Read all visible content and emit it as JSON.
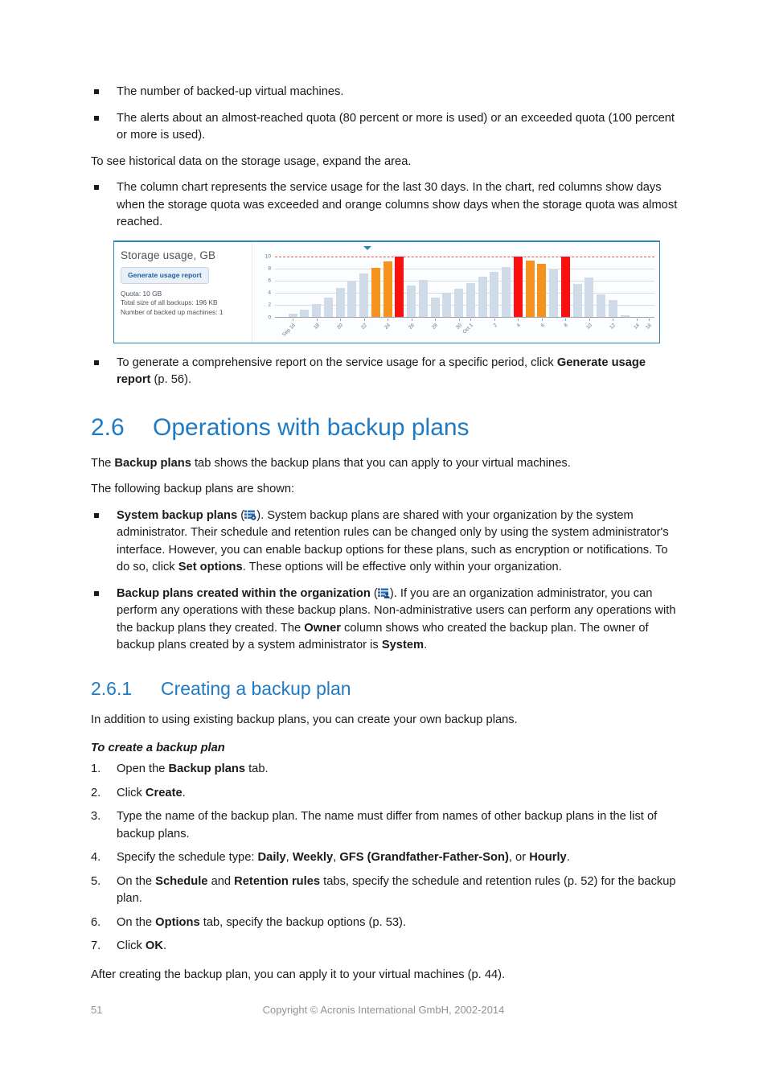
{
  "page": {
    "number": "51",
    "copyright": "Copyright © Acronis International GmbH, 2002-2014"
  },
  "intro_bullets": [
    "The number of backed-up virtual machines.",
    "The alerts about an almost-reached quota (80 percent or more is used) or an exceeded quota (100 percent or more is used)."
  ],
  "intro_paragraph": "To see historical data on the storage usage, expand the area.",
  "chart_bullet": "The column chart represents the service usage for the last 30 days. In the chart, red columns show days when the storage quota was exceeded and orange columns show days when the storage quota was almost reached.",
  "report_bullet": {
    "before": "To generate a comprehensive report on the service usage for a specific period, click ",
    "bold": "Generate usage report",
    "after": " (p. 56)."
  },
  "widget": {
    "title": "Storage usage, GB",
    "button_label": "Generate usage report",
    "quota_text": "Quota: 10 GB",
    "total_size_text": "Total size of all backups: 196 KB",
    "machines_text": "Number of backed up machines: 1",
    "collapse_icon": "caret-down-icon",
    "colors": {
      "normal_bar": "#cfdbe8",
      "warning_bar": "#f6921e",
      "exceeded_bar": "#fb0f0f",
      "quota_line": "#f0504a",
      "accent": "#2e86bf"
    }
  },
  "chart_data": {
    "type": "bar",
    "title": "Storage usage, GB",
    "xlabel": "",
    "ylabel": "",
    "ylim": [
      0,
      10
    ],
    "yticks": [
      0,
      2,
      4,
      6,
      8,
      10
    ],
    "grid": true,
    "legend": null,
    "quota_level": 10,
    "categories": [
      "Sep 15",
      "Sep 16",
      "Sep 17",
      "Sep 18",
      "Sep 19",
      "Sep 20",
      "Sep 21",
      "Sep 22",
      "Sep 23",
      "Sep 24",
      "Sep 25",
      "Sep 26",
      "Sep 27",
      "Sep 28",
      "Sep 29",
      "Sep 30",
      "Oct 1",
      "Oct 2",
      "Oct 3",
      "Oct 4",
      "Oct 5",
      "Oct 6",
      "Oct 7",
      "Oct 8",
      "Oct 9",
      "Oct 10",
      "Oct 11",
      "Oct 12",
      "Oct 13",
      "Oct 14",
      "Oct 15",
      "Oct 16"
    ],
    "tick_labels": [
      "",
      "Sep 16",
      "",
      "18",
      "",
      "20",
      "",
      "22",
      "",
      "24",
      "",
      "26",
      "",
      "28",
      "",
      "30",
      "Oct 1",
      "",
      "2",
      "",
      "4",
      "",
      "6",
      "",
      "8",
      "",
      "10",
      "",
      "12",
      "",
      "14",
      "16"
    ],
    "values": [
      0,
      0.6,
      1.2,
      2.2,
      3.2,
      4.8,
      5.9,
      7.2,
      8.1,
      9.1,
      10,
      5.2,
      6.1,
      3.2,
      4.0,
      4.7,
      5.6,
      6.6,
      7.4,
      8.2,
      10,
      9.3,
      8.8,
      7.8,
      10,
      5.5,
      6.5,
      3.8,
      2.8,
      0.3,
      0,
      0
    ],
    "bar_states": [
      "normal",
      "normal",
      "normal",
      "normal",
      "normal",
      "normal",
      "normal",
      "normal",
      "warning",
      "warning",
      "exceeded",
      "normal",
      "normal",
      "normal",
      "normal",
      "normal",
      "normal",
      "normal",
      "normal",
      "normal",
      "exceeded",
      "warning",
      "warning",
      "normal",
      "exceeded",
      "normal",
      "normal",
      "normal",
      "normal",
      "normal",
      "normal",
      "normal"
    ]
  },
  "section_26": {
    "number": "2.6",
    "title": "Operations with backup plans",
    "intro": {
      "before": "The ",
      "bold": "Backup plans",
      "after": " tab shows the backup plans that you can apply to your virtual machines."
    },
    "lead_in": "The following backup plans are shown:",
    "bullets": [
      {
        "bold_lead": "System backup plans",
        "icon": "system-backup-plan-icon",
        "text": "). System backup plans are shared with your organization by the system administrator. Their schedule and retention rules can be changed only by using the system administrator's interface. However, you can enable backup options for these plans, such as encryption or notifications. To do so, click ",
        "bold_mid": "Set options",
        "text_end": ". These options will be effective only within your organization."
      },
      {
        "bold_lead": "Backup plans created within the organization",
        "icon": "organization-backup-plan-icon",
        "text": "). If you are an organization administrator, you can perform any operations with these backup plans. Non-administrative users can perform any operations with the backup plans they created. The ",
        "bold_mid": "Owner",
        "text_mid2": " column shows who created the backup plan. The owner of backup plans created by a system administrator is ",
        "bold_end": "System",
        "text_end": "."
      }
    ]
  },
  "section_261": {
    "number": "2.6.1",
    "title": "Creating a backup plan",
    "intro": "In addition to using existing backup plans, you can create your own backup plans.",
    "procedure_heading": "To create a backup plan",
    "steps": [
      {
        "before": "Open the ",
        "bold": "Backup plans",
        "after": " tab."
      },
      {
        "before": "Click ",
        "bold": "Create",
        "after": "."
      },
      {
        "before": "Type the name of the backup plan. The name must differ from names of other backup plans in the list of backup plans.",
        "bold": "",
        "after": ""
      },
      {
        "before": "Specify the schedule type: ",
        "bold": "Daily",
        "mid1": ", ",
        "bold2": "Weekly",
        "mid2": ", ",
        "bold3": "GFS (Grandfather-Father-Son)",
        "mid3": ", or ",
        "bold4": "Hourly",
        "after": "."
      },
      {
        "before": "On the ",
        "bold": "Schedule",
        "mid1": " and ",
        "bold2": "Retention rules",
        "after": " tabs, specify the schedule and retention rules (p. 52) for the backup plan."
      },
      {
        "before": "On the ",
        "bold": "Options",
        "after": " tab, specify the backup options (p. 53)."
      },
      {
        "before": "Click ",
        "bold": "OK",
        "after": "."
      }
    ],
    "closing": "After creating the backup plan, you can apply it to your virtual machines (p. 44)."
  }
}
